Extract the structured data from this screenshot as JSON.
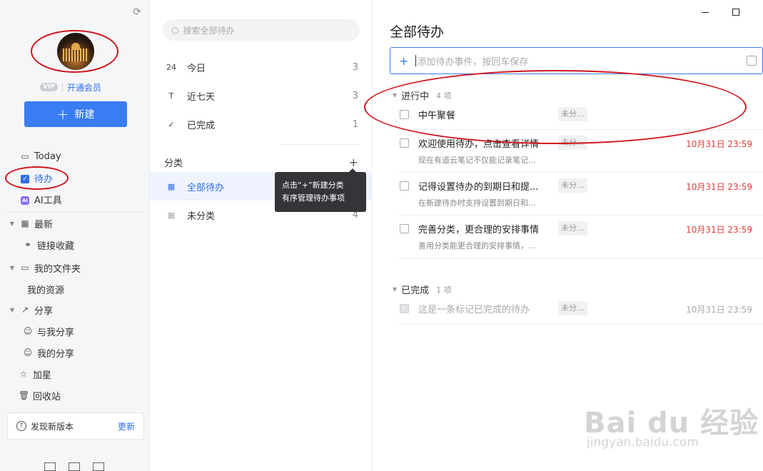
{
  "sidebar": {
    "vip": {
      "badge": "VIP",
      "link": "开通会员"
    },
    "new_button": {
      "plus": "+",
      "label": "新建"
    },
    "items": [
      {
        "label": "Today",
        "icon": "calendar-icon"
      },
      {
        "label": "待办",
        "icon": "checkbox-icon"
      },
      {
        "label": "AI工具",
        "icon": "ai-icon"
      },
      {
        "label": "最新",
        "icon": "grid-icon"
      },
      {
        "label": "链接收藏",
        "icon": "link-icon"
      },
      {
        "label": "我的文件夹",
        "icon": "folder-icon"
      },
      {
        "label": "我的资源",
        "icon": ""
      },
      {
        "label": "分享",
        "icon": "share-icon"
      },
      {
        "label": "与我分享",
        "icon": "user-icon"
      },
      {
        "label": "我的分享",
        "icon": "user-icon"
      },
      {
        "label": "加星",
        "icon": "star-icon"
      },
      {
        "label": "回收站",
        "icon": "trash-icon"
      }
    ],
    "update": {
      "text": "发现新版本",
      "link": "更新"
    }
  },
  "middle": {
    "search_placeholder": "搜索全部待办",
    "smart_lists": [
      {
        "label": "今日",
        "icon_text": "24",
        "count": "3"
      },
      {
        "label": "近七天",
        "icon_text": "T",
        "count": "3"
      },
      {
        "label": "已完成",
        "icon_text": "✓",
        "count": "1"
      }
    ],
    "category_title": "分类",
    "category_add": "+",
    "categories": [
      {
        "label": "全部待办",
        "count": ""
      },
      {
        "label": "未分类",
        "count": "4"
      }
    ],
    "tooltip": {
      "line1": "点击“+”新建分类",
      "line2": "有序管理待办事项"
    }
  },
  "main": {
    "title": "全部待办",
    "add_placeholder": "添加待办事件，按回车保存",
    "in_progress": {
      "label": "进行中",
      "count": "4 项"
    },
    "tasks": [
      {
        "title": "中午聚餐",
        "desc": "",
        "tag": "未分...",
        "date": ""
      },
      {
        "title": "欢迎使用待办，点击查看详情",
        "desc": "现在有道云笔记不仅能记录笔记...",
        "tag": "未分...",
        "date": "10月31日 23:59"
      },
      {
        "title": "记得设置待办的到期日和提...",
        "desc": "在新建待办时支持设置到期日和...",
        "tag": "未分...",
        "date": "10月31日 23:59"
      },
      {
        "title": "完善分类，更合理的安排事情",
        "desc": "善用分类能更合理的安排事情，...",
        "tag": "未分...",
        "date": "10月31日 23:59"
      }
    ],
    "done": {
      "label": "已完成",
      "count": "1 项"
    },
    "done_tasks": [
      {
        "title": "这是一条标记已完成的待办",
        "tag": "未分...",
        "date": "10月31日 23:59"
      }
    ]
  },
  "watermark": {
    "line1": "Bai du 经验",
    "line2": "jingyan.baidu.com"
  },
  "colors": {
    "accent": "#3a7cf3",
    "due": "#e2393a",
    "annotation": "#d0141c"
  }
}
